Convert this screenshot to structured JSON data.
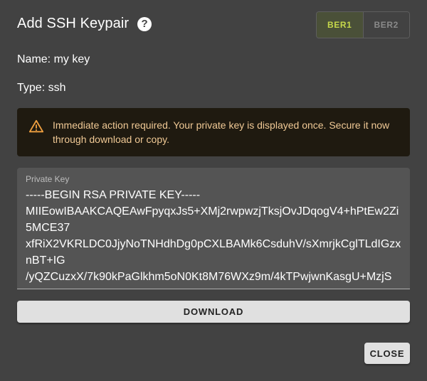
{
  "dialog": {
    "title": "Add SSH Keypair",
    "help_icon": "question-circle-icon",
    "help_glyph": "?"
  },
  "toggle": {
    "options": [
      {
        "label": "BER1",
        "selected": true
      },
      {
        "label": "BER2",
        "selected": false
      }
    ]
  },
  "details": {
    "name_line": "Name: my key",
    "type_line": "Type: ssh"
  },
  "alert": {
    "icon": "warning-triangle-icon",
    "color": "#f0c995",
    "message": "Immediate action required. Your private key is displayed once. Secure it now through download or copy."
  },
  "private_key": {
    "label": "Private Key",
    "value": "-----BEGIN RSA PRIVATE KEY-----\nMIIEowIBAAKCAQEAwFpyqxJs5+XMj2rwpwzjTksjOvJDqogV4+hPtEw2Zi5MCE37\nxfRiX2VKRLDC0JjyNoTNHdhDg0pCXLBAMk6CsduhV/sXmrjkCglTLdIGzxnBT+IG\n/yQZCuzxX/7k90kPaGlkhm5oN0Kt8M76WXz9m/4kTPwjwnKasgU+MzjS"
  },
  "actions": {
    "download_label": "DOWNLOAD",
    "close_label": "CLOSE"
  },
  "colors": {
    "accent": "#c6d84a",
    "background": "#424242"
  }
}
